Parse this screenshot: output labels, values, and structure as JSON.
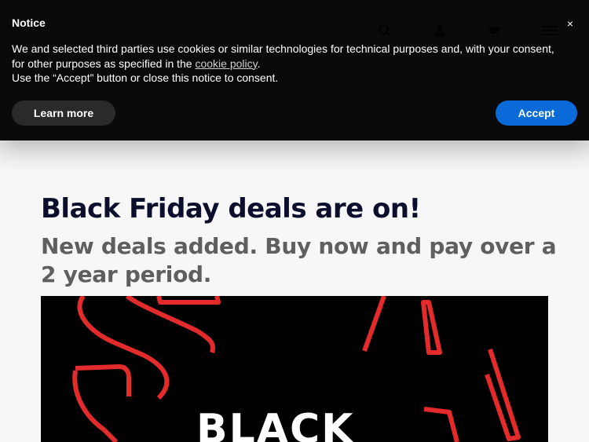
{
  "site_header": {
    "brand": "",
    "icons": [
      "search-icon",
      "user-icon",
      "cart-icon",
      "menu-icon"
    ]
  },
  "hero": {
    "title": "Black Friday deals are on!",
    "subtitle": "New deals added. Buy now and pay over a 2 year period.",
    "banner_text": "BLACK",
    "banner_accent_color": "#e32b2b"
  },
  "cookie_notice": {
    "title": "Notice",
    "close_label": "×",
    "body_prefix": "We and selected third parties use cookies or similar technologies for technical purposes and, with your consent, for other purposes as specified in the",
    "link_text": "cookie policy",
    "body_suffix": ".",
    "body_line2": "Use the “Accept” button or close this notice to consent.",
    "learn_more_label": "Learn more",
    "accept_label": "Accept",
    "accept_color": "#0a6bd8"
  }
}
